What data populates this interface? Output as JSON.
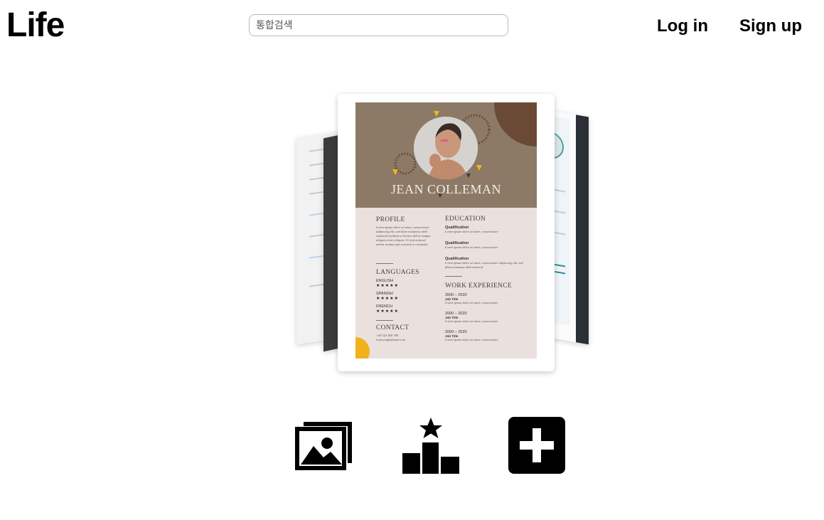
{
  "header": {
    "logo": "Life",
    "search_placeholder": "통합검색",
    "login_label": "Log in",
    "signup_label": "Sign up"
  },
  "featured_resume": {
    "name": "JEAN COLLEMAN",
    "profile_heading": "PROFILE",
    "profile_text": "Lorem ipsum dolor sit amet, consectetuer adipiscing elit, sed diam nonummy nibh euismod tincidunt ut laoreet dolore magna aliquam erat volutpat. Ut wisi enim ad minim veniam quis nostrud ex commodo.",
    "languages_heading": "LANGUAGES",
    "languages": [
      {
        "name": "ENGLISH",
        "stars": "★★★★★"
      },
      {
        "name": "SPANISH",
        "stars": "★★★★★"
      },
      {
        "name": "FRENCH",
        "stars": "★★★★★"
      }
    ],
    "contact_heading": "CONTACT",
    "contact_phone": "+00 123 456 789",
    "contact_email": "louiswright@mail.com",
    "education_heading": "EDUCATION",
    "education": [
      {
        "title": "Qualification",
        "text": "Lorem ipsum dolor sit amet, consectetuer"
      },
      {
        "title": "Qualification",
        "text": "Lorem ipsum dolor sit amet, consectetuer"
      },
      {
        "title": "Qualification",
        "text": "Lorem ipsum dolor sit amet, consectetuer adipiscing elit, sed diam nonummy nibh euismod"
      }
    ],
    "work_heading": "WORK EXPERIENCE",
    "work": [
      {
        "years": "2000 – 2020",
        "title": "Job Title",
        "text": "Lorem ipsum dolor sit amet, consectetuer"
      },
      {
        "years": "2000 – 2020",
        "title": "Job Title",
        "text": "Lorem ipsum dolor sit amet, consectetuer"
      },
      {
        "years": "2000 – 2020",
        "title": "Job Title",
        "text": "Lorem ipsum dolor sit amet, consectetuer"
      }
    ]
  },
  "actions": {
    "gallery_icon": "gallery-icon",
    "ranking_icon": "ranking-podium-icon",
    "add_icon": "add-square-icon"
  },
  "colors": {
    "resume_header": "#8c7a66",
    "resume_body": "#eae0dd",
    "accent_yellow": "#f1b11c"
  }
}
